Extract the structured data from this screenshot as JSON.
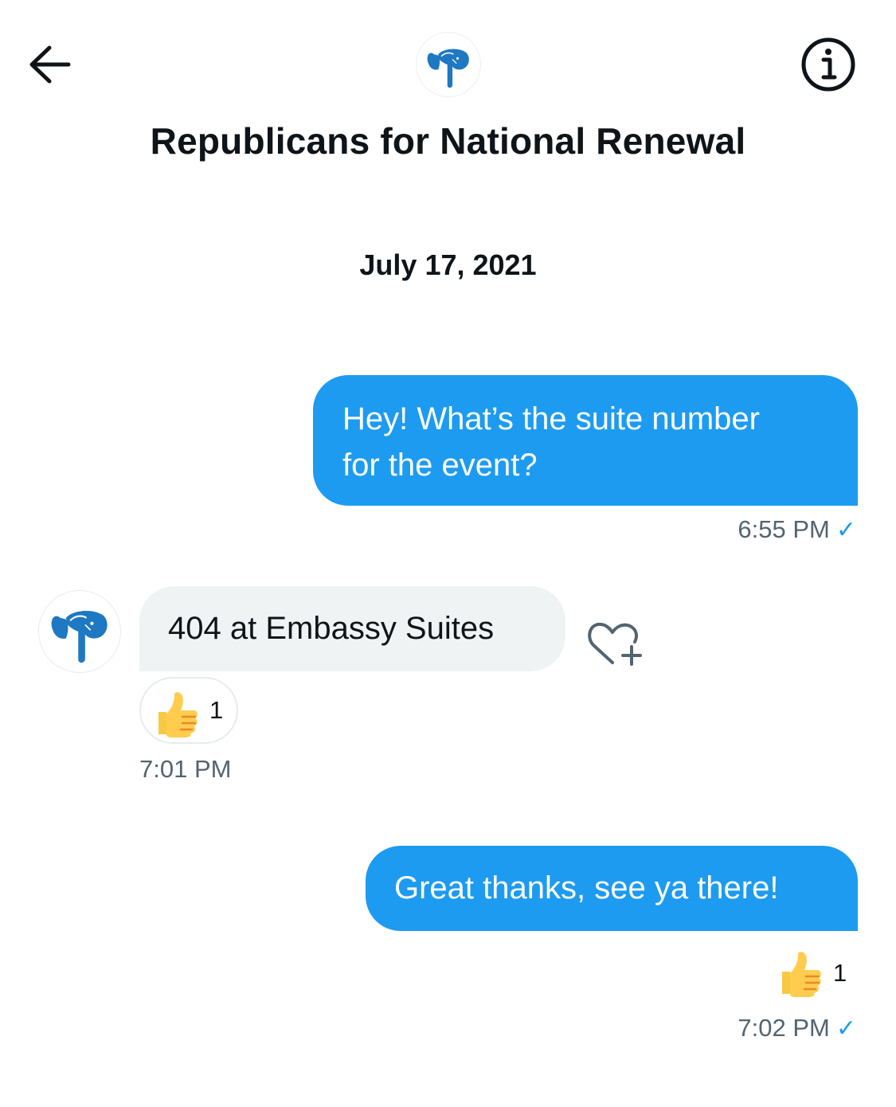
{
  "header": {
    "title": "Republicans for National Renewal",
    "back_icon": "arrow-left-icon",
    "info_icon": "info-icon",
    "avatar_icon": "elephant-logo-icon"
  },
  "conversation": {
    "date": "July 17, 2021",
    "messages": [
      {
        "direction": "outgoing",
        "text_line1": "Hey! What’s the suite number",
        "text_line2": "for the event?",
        "time": "6:55 PM",
        "status_icon": "check-icon"
      },
      {
        "direction": "incoming",
        "text": "404 at Embassy Suites",
        "time": "7:01 PM",
        "reaction": {
          "emoji": "thumbs-up-icon",
          "count": "1"
        },
        "add_reaction_icon": "heart-plus-icon"
      },
      {
        "direction": "outgoing",
        "text": "Great thanks, see ya there!",
        "time": "7:02 PM",
        "status_icon": "check-icon",
        "reaction": {
          "emoji": "thumbs-up-icon",
          "count": "1"
        }
      }
    ]
  },
  "colors": {
    "accent": "#1d9bf0",
    "incoming_bubble": "#eff3f4",
    "secondary_text": "#536471",
    "logo_blue": "#1e78c2"
  }
}
